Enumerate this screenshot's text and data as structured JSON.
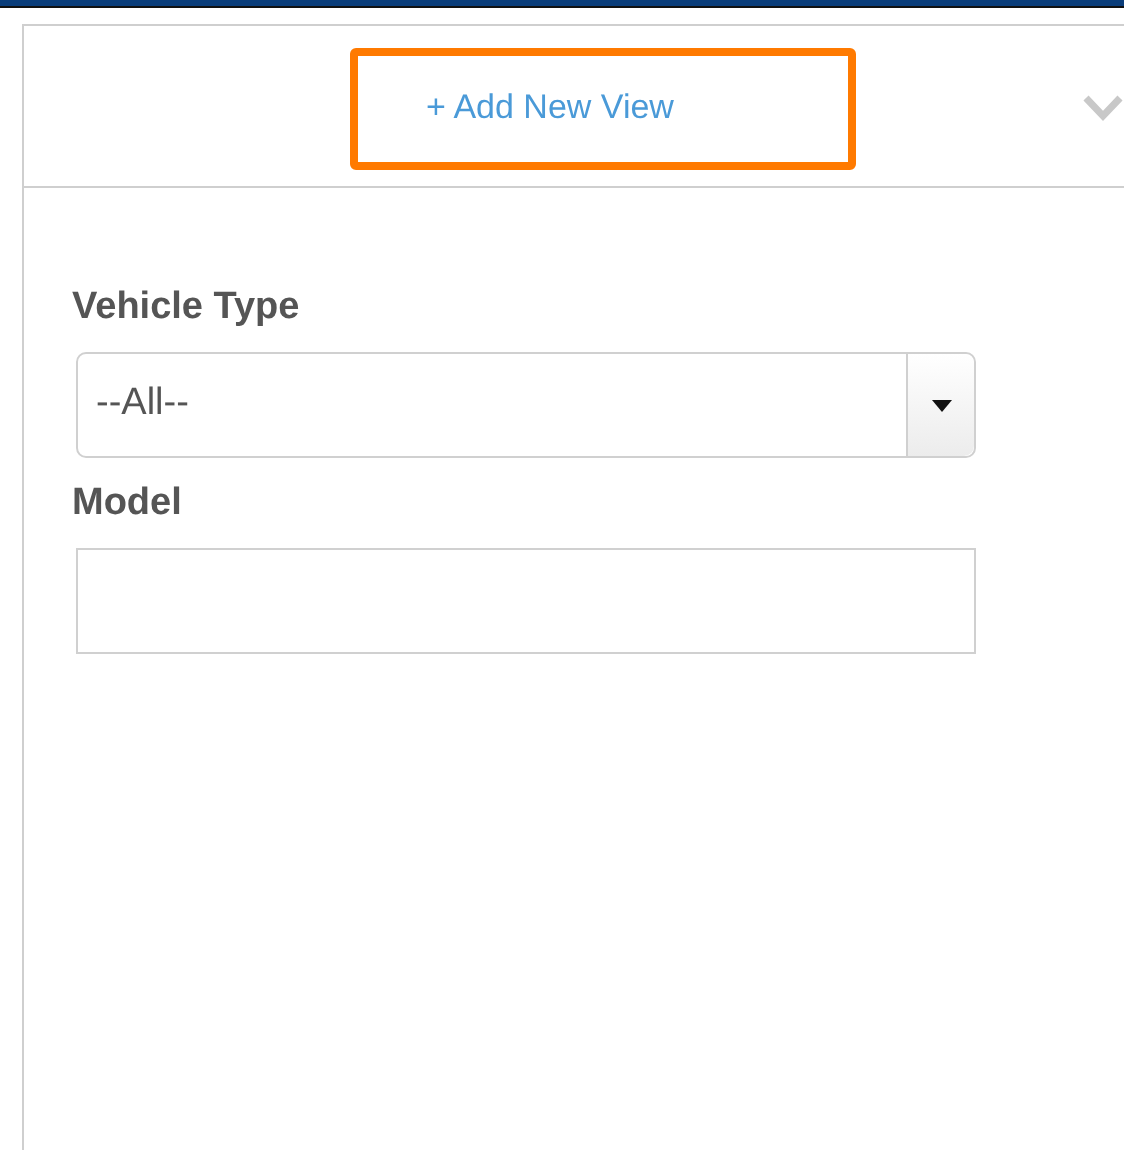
{
  "header": {
    "add_view_link": "+ Add New View",
    "highlighted": true,
    "expanded": false
  },
  "fields": [
    {
      "kind": "select",
      "label": "Vehicle Type",
      "value": "--All--"
    },
    {
      "kind": "text",
      "label": "Model"
    }
  ]
}
